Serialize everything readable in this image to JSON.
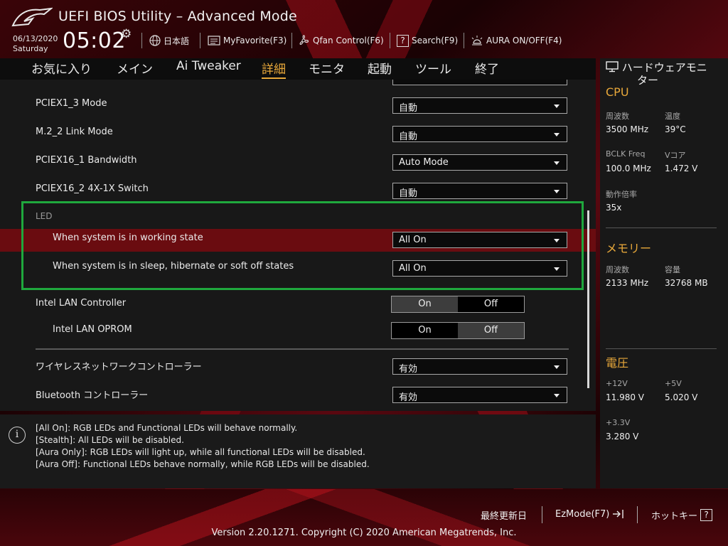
{
  "header": {
    "title": "UEFI BIOS Utility – Advanced Mode",
    "date": "06/13/2020",
    "day": "Saturday",
    "time": "05:02",
    "tools": [
      {
        "label": "日本語",
        "icon": "globe-icon"
      },
      {
        "label": "MyFavorite(F3)",
        "icon": "favorite-icon"
      },
      {
        "label": "Qfan Control(F6)",
        "icon": "fan-icon"
      },
      {
        "label": "Search(F9)",
        "icon": "question-icon"
      },
      {
        "label": "AURA ON/OFF(F4)",
        "icon": "aura-icon"
      }
    ]
  },
  "menu": {
    "items": [
      "お気に入り",
      "メイン",
      "Ai Tweaker",
      "詳細",
      "モニタ",
      "起動",
      "ツール",
      "終了"
    ],
    "active": "詳細"
  },
  "settings": {
    "pciex1_3": {
      "label": "PCIEX1_3 Mode",
      "value": "自動"
    },
    "m2_2": {
      "label": "M.2_2 Link Mode",
      "value": "自動"
    },
    "pciex16_1": {
      "label": "PCIEX16_1 Bandwidth",
      "value": "Auto Mode"
    },
    "pciex16_2": {
      "label": "PCIEX16_2 4X-1X Switch",
      "value": "自動"
    },
    "led_header": "LED",
    "led_working": {
      "label": "When system is in working state",
      "value": "All On"
    },
    "led_sleep": {
      "label": "When system is in sleep, hibernate or soft off states",
      "value": "All On"
    },
    "lan_controller": {
      "label": "Intel LAN Controller",
      "on": "On",
      "off": "Off",
      "selected": "On"
    },
    "lan_oprom": {
      "label": "Intel LAN OPROM",
      "on": "On",
      "off": "Off",
      "selected": "Off"
    },
    "wireless": {
      "label": "ワイヤレスネットワークコントローラー",
      "value": "有効"
    },
    "bluetooth": {
      "label": "Bluetooth コントローラー",
      "value": "有効"
    }
  },
  "help": {
    "lines": [
      "[All On]: RGB LEDs and Functional LEDs will behave normally.",
      "[Stealth]: All LEDs will be disabled.",
      "[Aura Only]: RGB LEDs will light up, while all functional LEDs will be disabled.",
      "[Aura Off]: Functional LEDs behave normally, while RGB LEDs will be disabled."
    ]
  },
  "hwmon": {
    "title_line1": "ハードウェアモニ",
    "title_line2": "ター",
    "cpu": {
      "title": "CPU",
      "freq_label": "周波数",
      "freq": "3500 MHz",
      "temp_label": "温度",
      "temp": "39°C",
      "bclk_label": "BCLK Freq",
      "bclk": "100.0 MHz",
      "vcore_label": "Vコア",
      "vcore": "1.472 V",
      "ratio_label": "動作倍率",
      "ratio": "35x"
    },
    "memory": {
      "title": "メモリー",
      "freq_label": "周波数",
      "freq": "2133 MHz",
      "cap_label": "容量",
      "cap": "32768 MB"
    },
    "voltage": {
      "title": "電圧",
      "v12_label": "+12V",
      "v12": "11.980 V",
      "v5_label": "+5V",
      "v5": "5.020 V",
      "v33_label": "+3.3V",
      "v33": "3.280 V"
    }
  },
  "footer": {
    "last_modified": "最終更新日",
    "ezmode": "EzMode(F7)",
    "hotkeys": "ホットキー",
    "hotkey_glyph": "?",
    "version": "Version 2.20.1271. Copyright (C) 2020 American Megatrends, Inc."
  },
  "colors": {
    "accent": "#e8a83a",
    "highlight_row": "#6a0c10",
    "annotation_box": "#1fa83d"
  }
}
